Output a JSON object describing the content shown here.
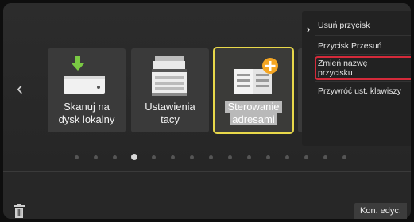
{
  "tiles": [
    {
      "label_line1": "Skanuj na",
      "label_line2": "dysk lokalny",
      "icon": "download-drive-icon"
    },
    {
      "label_line1": "Ustawienia",
      "label_line2": "tacy",
      "icon": "printer-tray-icon"
    },
    {
      "label_line1": "Sterowanie",
      "label_line2": "adresami",
      "icon": "address-book-add-icon"
    }
  ],
  "context_menu": {
    "items": [
      {
        "label": "Usuń przycisk"
      },
      {
        "label": "Przycisk Przesuń"
      },
      {
        "label_line1": "Zmień nazwę",
        "label_line2": "przycisku"
      },
      {
        "label": "Przywróć ust. klawiszy"
      }
    ],
    "highlight_color": "#d42a3a"
  },
  "pager": {
    "total_dots": 15,
    "active_index": 3
  },
  "footer": {
    "done_label": "Kon. edyc."
  },
  "colors": {
    "selected_outline": "#e8d84a",
    "download_arrow": "#7ac943",
    "add_badge": "#f5a623"
  }
}
